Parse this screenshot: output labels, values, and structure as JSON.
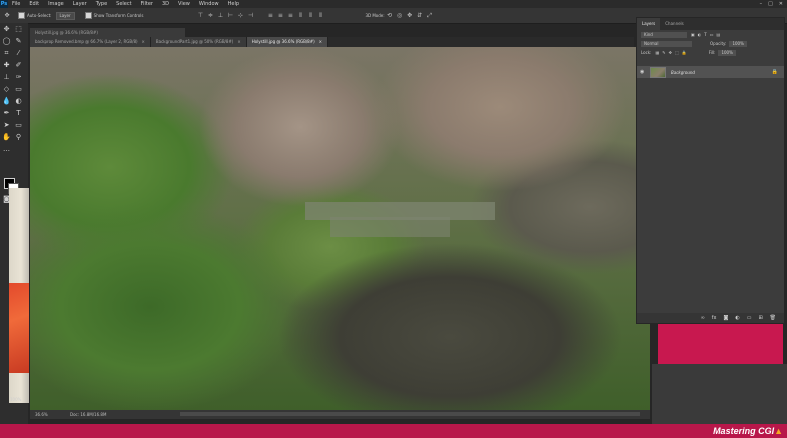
{
  "menu": {
    "items": [
      "File",
      "Edit",
      "Image",
      "Layer",
      "Type",
      "Select",
      "Filter",
      "3D",
      "View",
      "Window",
      "Help"
    ]
  },
  "options": {
    "auto_select_label": "Auto-Select:",
    "auto_select_value": "Layer",
    "show_transform_label": "Show Transform Controls",
    "mode_3d_label": "3D Mode:"
  },
  "floating_window": {
    "title": "Holystill.jpg @ 36.6% (RGB/8#)"
  },
  "tabs": [
    {
      "label": "backprop Removed.bmp @ 66.7% (Layer 2, RGB/8)"
    },
    {
      "label": "BackgroundPart1.jpg @ 50% (RGB/8#)"
    },
    {
      "label": "Holystill.jpg @ 36.6% (RGB/8#)"
    }
  ],
  "status": {
    "zoom": "36.6%",
    "doc": "Doc: 16.8M/16.8M"
  },
  "left_doc": {
    "zoom": "100%"
  },
  "layers_panel": {
    "tabs": [
      "Layers",
      "Channels"
    ],
    "kind_label": "Kind",
    "mode_label": "Normal",
    "opacity_label": "Opacity:",
    "opacity_value": "100%",
    "lock_label": "Lock:",
    "fill_label": "Fill:",
    "fill_value": "100%",
    "layer_name": "Background"
  },
  "brand": {
    "text": "Mastering CGI"
  },
  "colors": {
    "accent": "#c8184f",
    "panel": "#3c3c3c",
    "canvas": "#556d3c"
  }
}
